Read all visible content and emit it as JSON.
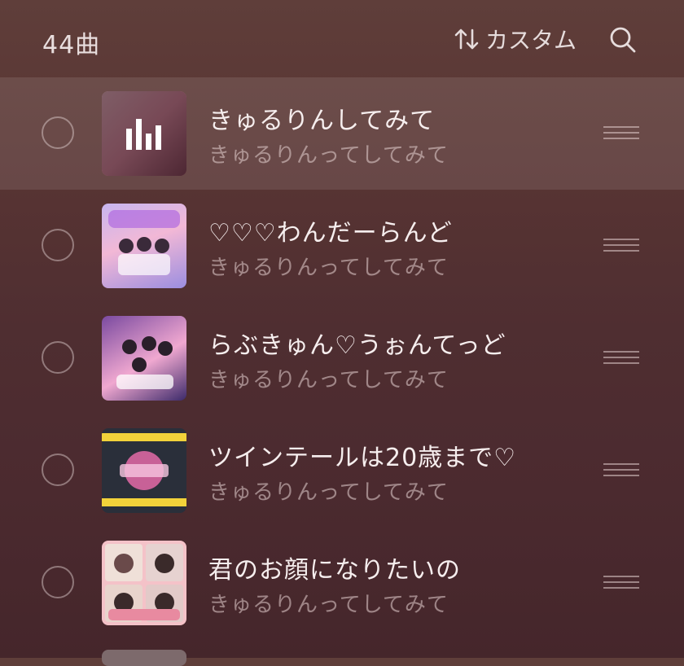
{
  "header": {
    "count_label": "44曲",
    "sort_label": "カスタム",
    "sort_icon": "sort-arrows-icon",
    "search_icon": "search-icon"
  },
  "songs": [
    {
      "title": "きゅるりんしてみて",
      "artist": "きゅるりんってしてみて",
      "playing": true,
      "cover_colors": [
        "#e8b7c4",
        "#d98aa0",
        "#7a3e52"
      ]
    },
    {
      "title": "♡♡♡わんだーらんど",
      "artist": "きゅるりんってしてみて",
      "playing": false,
      "cover_colors": [
        "#c7b6f0",
        "#f2b8d6",
        "#9b8ee0"
      ]
    },
    {
      "title": "らぶきゅん♡うぉんてっど",
      "artist": "きゅるりんってしてみて",
      "playing": false,
      "cover_colors": [
        "#7a4aa0",
        "#f0a8d0",
        "#3c2a6a"
      ]
    },
    {
      "title": "ツインテールは20歳まで♡",
      "artist": "きゅるりんってしてみて",
      "playing": false,
      "cover_colors": [
        "#2a2f3a",
        "#f2d23a",
        "#e46aa8"
      ]
    },
    {
      "title": "君のお顔になりたいの",
      "artist": "きゅるりんってしてみて",
      "playing": false,
      "cover_colors": [
        "#f4c2c8",
        "#6a4a4a",
        "#e88aa0"
      ]
    }
  ],
  "colors": {
    "background_top": "#5f3e3a",
    "background_bottom": "#45262b",
    "title_text": "#f6eeee",
    "secondary_text": "#bfaaaa"
  }
}
